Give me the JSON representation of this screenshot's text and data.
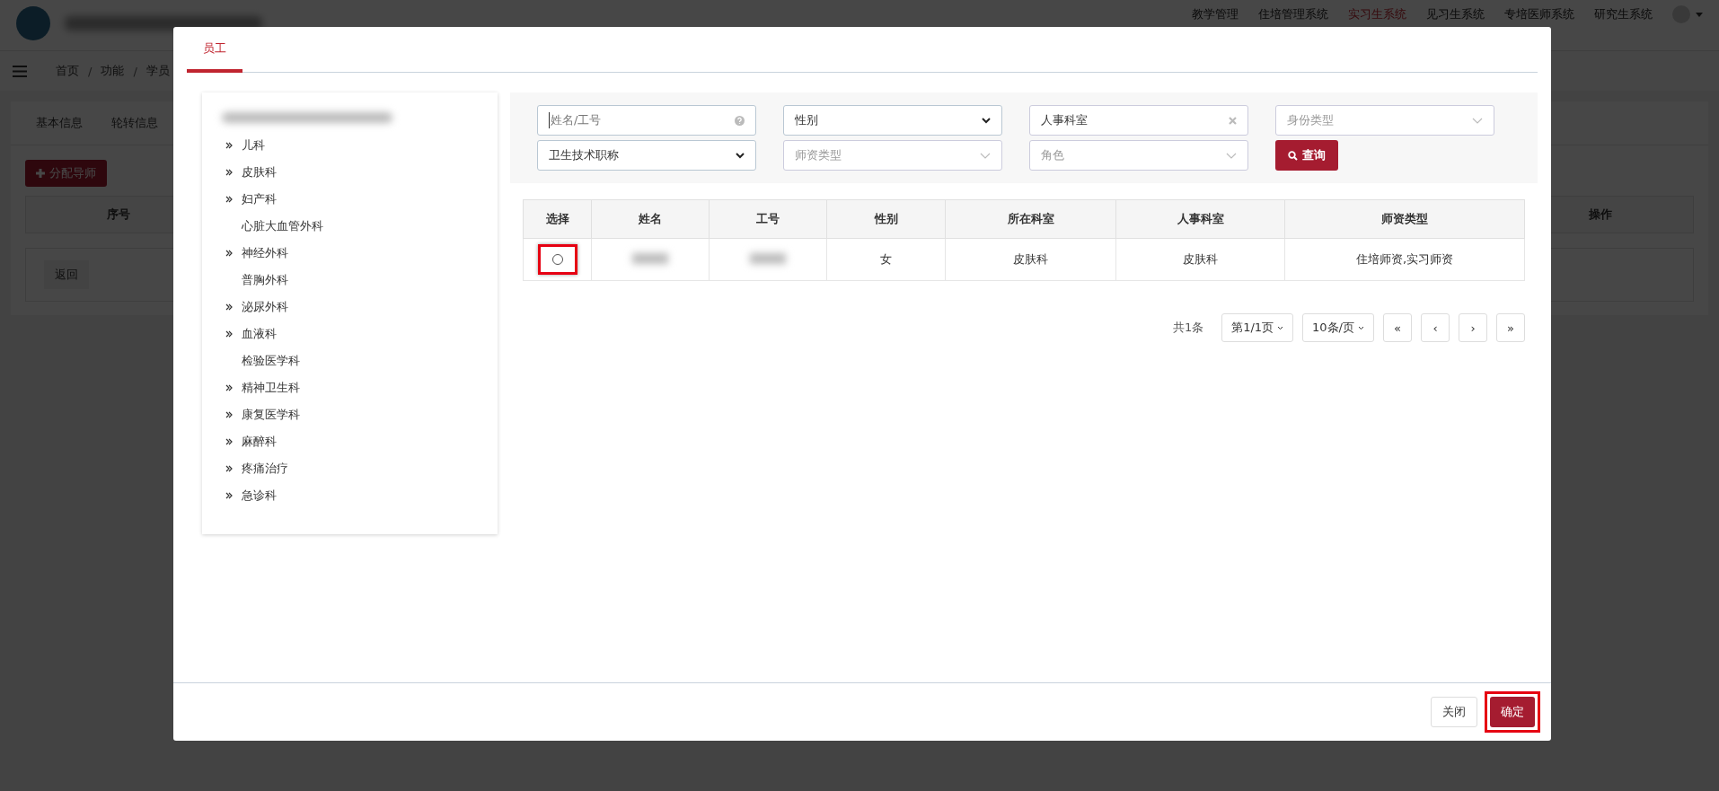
{
  "header": {
    "nav": [
      {
        "label": "教学管理",
        "selected": false
      },
      {
        "label": "住培管理系统",
        "selected": false
      },
      {
        "label": "实习生系统",
        "selected": true
      },
      {
        "label": "见习生系统",
        "selected": false
      },
      {
        "label": "专培医师系统",
        "selected": false
      },
      {
        "label": "研究生系统",
        "selected": false
      }
    ]
  },
  "breadcrumb": {
    "items": [
      "首页",
      "功能",
      "学员"
    ],
    "separator": "/"
  },
  "page": {
    "tabs": [
      "基本信息",
      "轮转信息"
    ],
    "add_button": "分配导师",
    "columns": [
      "序号",
      "操作"
    ],
    "back_button": "返回"
  },
  "modal": {
    "tabs": [
      {
        "label": "员工",
        "selected": true
      }
    ],
    "tree": [
      {
        "label": "儿科",
        "expandable": true
      },
      {
        "label": "皮肤科",
        "expandable": true
      },
      {
        "label": "妇产科",
        "expandable": true
      },
      {
        "label": "心脏大血管外科",
        "expandable": false
      },
      {
        "label": "神经外科",
        "expandable": true
      },
      {
        "label": "普胸外科",
        "expandable": false
      },
      {
        "label": "泌尿外科",
        "expandable": true
      },
      {
        "label": "血液科",
        "expandable": true
      },
      {
        "label": "检验医学科",
        "expandable": false
      },
      {
        "label": "精神卫生科",
        "expandable": true
      },
      {
        "label": "康复医学科",
        "expandable": true
      },
      {
        "label": "麻醉科",
        "expandable": true
      },
      {
        "label": "疼痛治疗",
        "expandable": true
      },
      {
        "label": "急诊科",
        "expandable": true
      }
    ],
    "filters": [
      {
        "kind": "text",
        "placeholder": "姓名/工号"
      },
      {
        "kind": "select",
        "value": "性别"
      },
      {
        "kind": "clearable",
        "value": "人事科室"
      },
      {
        "kind": "combo",
        "placeholder": "身份类型"
      },
      {
        "kind": "select",
        "value": "卫生技术职称"
      },
      {
        "kind": "combo",
        "placeholder": "师资类型"
      },
      {
        "kind": "combo",
        "placeholder": "角色"
      }
    ],
    "search_button": "查询",
    "table": {
      "columns": [
        "选择",
        "姓名",
        "工号",
        "性别",
        "所在科室",
        "人事科室",
        "师资类型"
      ],
      "rows": [
        {
          "selected": false,
          "highlighted": true,
          "cells": [
            {
              "kind": "radio"
            },
            {
              "kind": "blurred"
            },
            {
              "kind": "blurred"
            },
            {
              "kind": "text",
              "text": "女"
            },
            {
              "kind": "text",
              "text": "皮肤科"
            },
            {
              "kind": "text",
              "text": "皮肤科"
            },
            {
              "kind": "text",
              "text": "住培师资,实习师资"
            }
          ]
        }
      ]
    },
    "pagination": {
      "total": "共1条",
      "page": "第1/1页",
      "page_size": "10条/页",
      "buttons": [
        "«",
        "‹",
        "›",
        "»"
      ]
    },
    "footer": {
      "close": "关闭",
      "confirm": "确定",
      "confirm_highlighted": true
    }
  }
}
